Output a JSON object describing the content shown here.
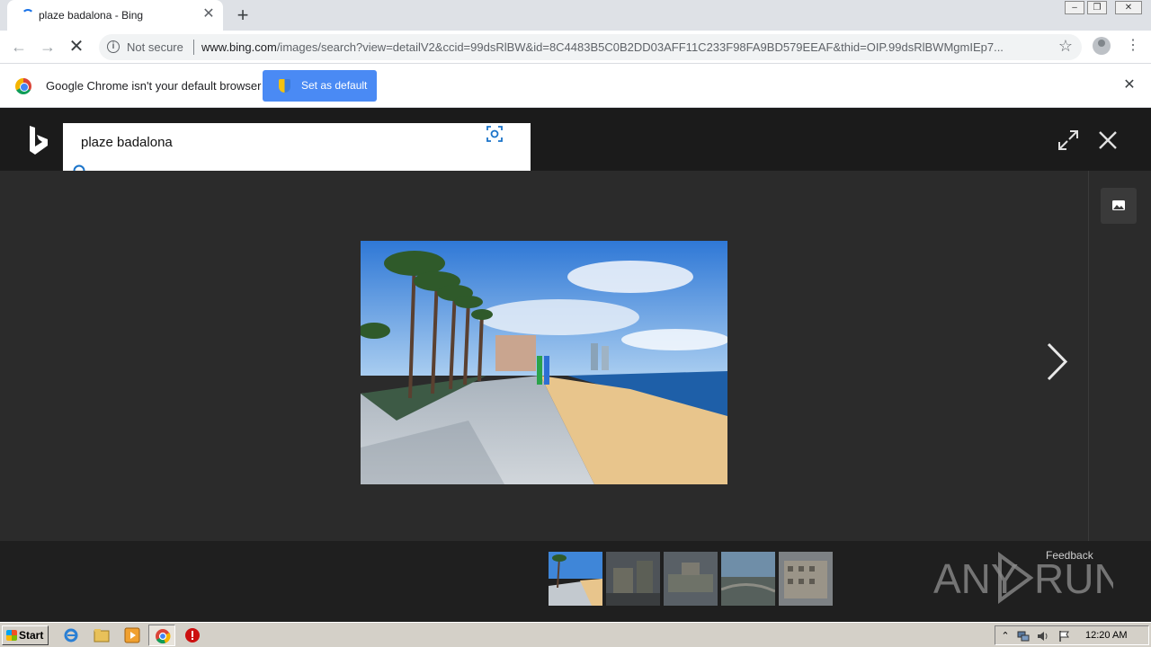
{
  "browser": {
    "tab_title": "plaze badalona - Bing",
    "tab_close": "✕",
    "new_tab": "+",
    "security_label": "Not secure",
    "url_host": "www.bing.com",
    "url_path": "/images/search?view=detailV2&ccid=99dsRlBW&id=8C4483B5C0B2DD03AFF11C233F98FA9BD579EEAF&thid=OIP.99dsRlBWMgmIEp7..."
  },
  "infobar": {
    "message": "Google Chrome isn't your default browser",
    "button_label": "Set as default",
    "close": "✕"
  },
  "bing": {
    "query": "plaze badalona",
    "feedback": "Feedback"
  },
  "taskbar": {
    "start_label": "Start",
    "clock": "12:20 AM"
  },
  "colors": {
    "accent_blue": "#4a8af4",
    "bing_header": "#1b1b1b",
    "viewer_bg": "#2b2b2b"
  }
}
